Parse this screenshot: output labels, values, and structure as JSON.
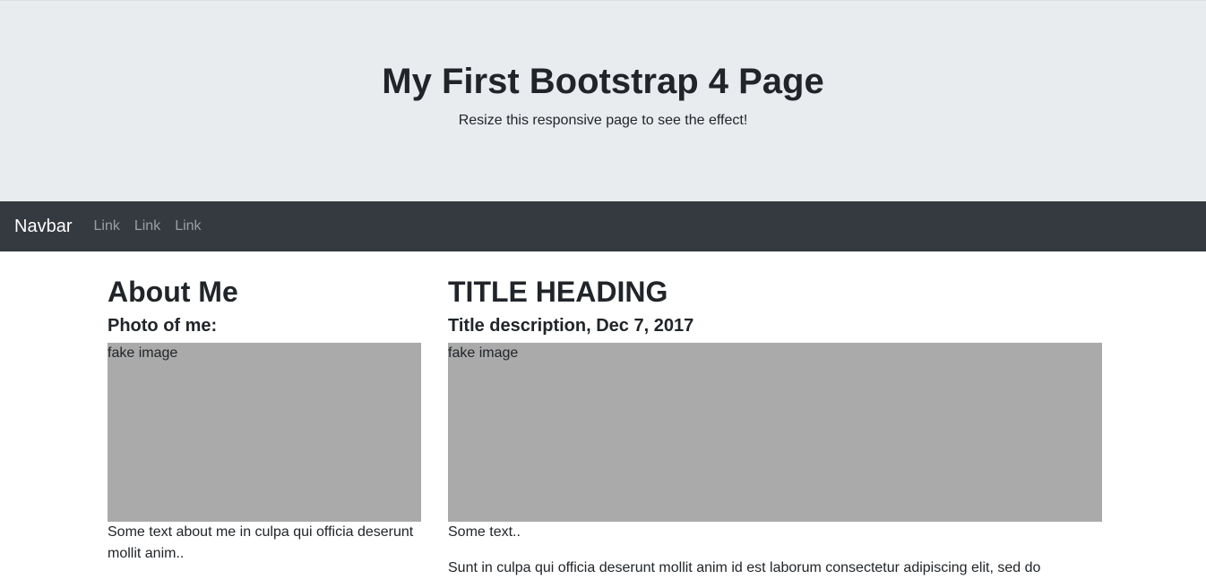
{
  "jumbotron": {
    "title": "My First Bootstrap 4 Page",
    "subtitle": "Resize this responsive page to see the effect!"
  },
  "navbar": {
    "brand": "Navbar",
    "links": [
      "Link",
      "Link",
      "Link"
    ]
  },
  "about": {
    "heading": "About Me",
    "photo_label": "Photo of me:",
    "image_text": "fake image",
    "text": "Some text about me in culpa qui officia deserunt mollit anim.."
  },
  "post": {
    "heading": "TITLE HEADING",
    "description": "Title description, Dec 7, 2017",
    "image_text": "fake image",
    "text": "Some text..",
    "body": "Sunt in culpa qui officia deserunt mollit anim id est laborum consectetur adipiscing elit, sed do"
  },
  "colors": {
    "jumbotron_bg": "#e9ecef",
    "navbar_bg": "#343a40",
    "fake_image_bg": "#aaaaaa"
  }
}
